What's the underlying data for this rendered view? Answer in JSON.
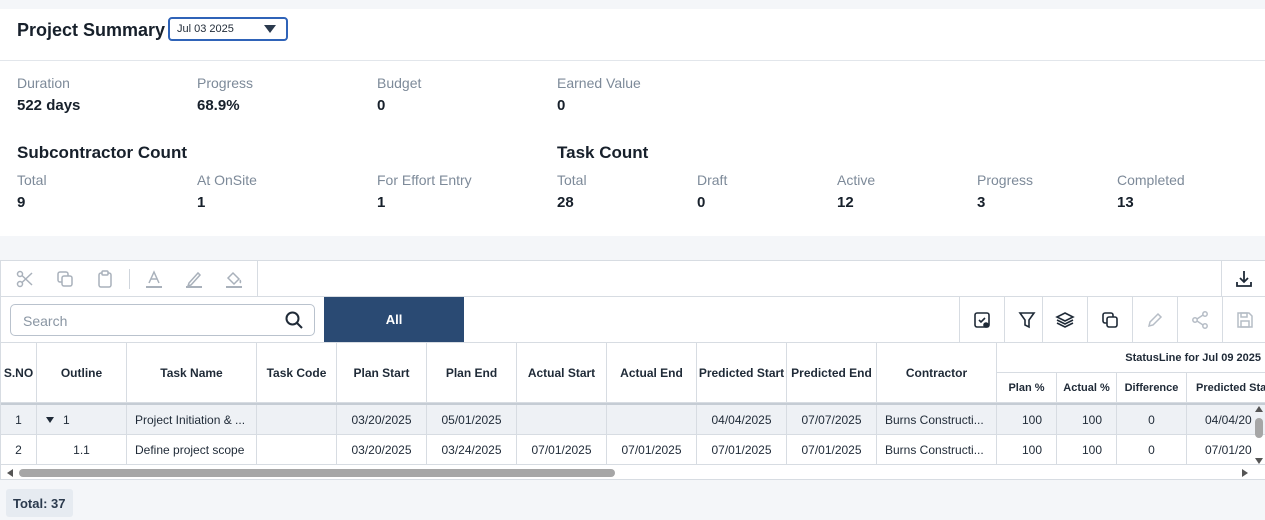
{
  "header": {
    "title": "Project Summary",
    "date_value": "Jul 03 2025"
  },
  "kpis": [
    {
      "label": "Duration",
      "value": "522 days"
    },
    {
      "label": "Progress",
      "value": "68.9%"
    },
    {
      "label": "Budget",
      "value": "0"
    },
    {
      "label": "Earned Value",
      "value": "0"
    }
  ],
  "subcontractor": {
    "title": "Subcontractor Count",
    "items": [
      {
        "label": "Total",
        "value": "9"
      },
      {
        "label": "At OnSite",
        "value": "1"
      },
      {
        "label": "For Effort Entry",
        "value": "1"
      }
    ]
  },
  "task_count": {
    "title": "Task Count",
    "items": [
      {
        "label": "Total",
        "value": "28"
      },
      {
        "label": "Draft",
        "value": "0"
      },
      {
        "label": "Active",
        "value": "12"
      },
      {
        "label": "Progress",
        "value": "3"
      },
      {
        "label": "Completed",
        "value": "13"
      }
    ]
  },
  "search": {
    "placeholder": "Search",
    "value": ""
  },
  "tabs": {
    "all_label": "All"
  },
  "table": {
    "headers": [
      "S.NO",
      "Outline",
      "Task Name",
      "Task Code",
      "Plan Start",
      "Plan End",
      "Actual Start",
      "Actual End",
      "Predicted Start",
      "Predicted End",
      "Contractor"
    ],
    "group_header": "StatusLine for Jul 09 2025",
    "sub_headers": [
      "Plan %",
      "Actual %",
      "Difference",
      "Predicted Sta"
    ],
    "rows": [
      [
        "1",
        "1",
        "Project Initiation & ...",
        "",
        "03/20/2025",
        "05/01/2025",
        "",
        "",
        "04/04/2025",
        "07/07/2025",
        "Burns Constructi...",
        "100",
        "100",
        "0",
        "04/04/20"
      ],
      [
        "2",
        "1.1",
        "Define project scope",
        "",
        "03/20/2025",
        "03/24/2025",
        "07/01/2025",
        "07/01/2025",
        "07/01/2025",
        "07/01/2025",
        "Burns Constructi...",
        "100",
        "100",
        "0",
        "07/01/20"
      ]
    ]
  },
  "footer": {
    "total": "Total: 37"
  }
}
